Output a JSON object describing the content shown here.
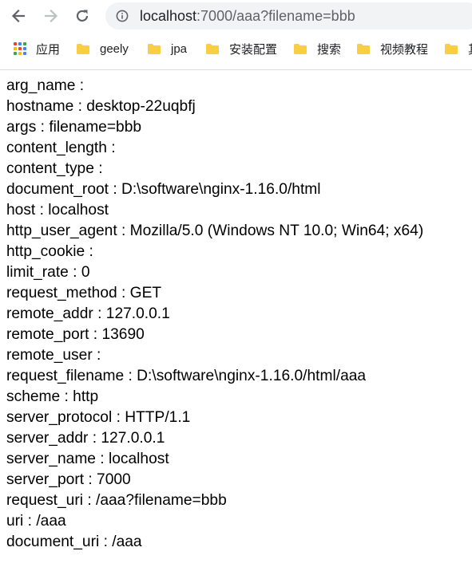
{
  "browser": {
    "url_host": "localhost",
    "url_rest": ":7000/aaa?filename=bbb",
    "bookmarks": [
      {
        "label": "应用",
        "icon": "apps-grid-icon"
      },
      {
        "label": "geely",
        "icon": "folder-icon"
      },
      {
        "label": "jpa",
        "icon": "folder-icon"
      },
      {
        "label": "安装配置",
        "icon": "folder-icon"
      },
      {
        "label": "搜索",
        "icon": "folder-icon"
      },
      {
        "label": "视频教程",
        "icon": "folder-icon"
      },
      {
        "label": "其",
        "icon": "folder-icon"
      }
    ],
    "colors": {
      "omnibox_bg": "#f1f3f4",
      "folder": "#f9ce45",
      "icon": "#5f6368"
    }
  },
  "page": {
    "lines": [
      "arg_name :",
      "hostname : desktop-22uqbfj",
      "args : filename=bbb",
      "content_length :",
      "content_type :",
      "document_root : D:\\software\\nginx-1.16.0/html",
      "host : localhost",
      "http_user_agent : Mozilla/5.0 (Windows NT 10.0; Win64; x64)",
      "http_cookie :",
      "limit_rate : 0",
      "request_method : GET",
      "remote_addr : 127.0.0.1",
      "remote_port : 13690",
      "remote_user :",
      "request_filename : D:\\software\\nginx-1.16.0/html/aaa",
      "scheme : http",
      "server_protocol : HTTP/1.1",
      "server_addr : 127.0.0.1",
      "server_name : localhost",
      "server_port : 7000",
      "request_uri : /aaa?filename=bbb",
      "uri : /aaa",
      "document_uri : /aaa"
    ]
  }
}
